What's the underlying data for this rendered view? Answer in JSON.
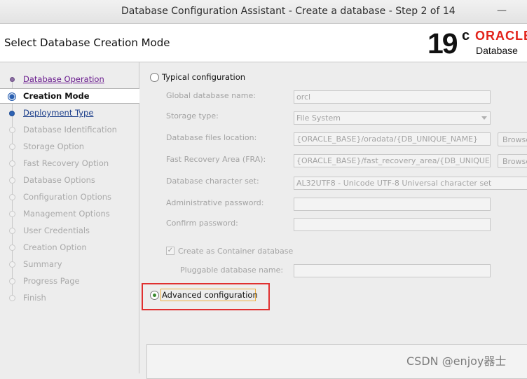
{
  "window": {
    "title": "Database Configuration Assistant - Create a database - Step 2 of 14",
    "minimize_glyph": "—"
  },
  "header": {
    "page_title": "Select Database Creation Mode",
    "logo": {
      "version": "19",
      "superscript": "c",
      "brand": "ORACLE",
      "product": "Database"
    }
  },
  "nav": {
    "items": [
      {
        "label": "Database Operation",
        "state": "done"
      },
      {
        "label": "Creation Mode",
        "state": "current"
      },
      {
        "label": "Deployment Type",
        "state": "next"
      },
      {
        "label": "Database Identification",
        "state": "disabled"
      },
      {
        "label": "Storage Option",
        "state": "disabled"
      },
      {
        "label": "Fast Recovery Option",
        "state": "disabled"
      },
      {
        "label": "Database Options",
        "state": "disabled"
      },
      {
        "label": "Configuration Options",
        "state": "disabled"
      },
      {
        "label": "Management Options",
        "state": "disabled"
      },
      {
        "label": "User Credentials",
        "state": "disabled"
      },
      {
        "label": "Creation Option",
        "state": "disabled"
      },
      {
        "label": "Summary",
        "state": "disabled"
      },
      {
        "label": "Progress Page",
        "state": "disabled"
      },
      {
        "label": "Finish",
        "state": "disabled"
      }
    ]
  },
  "form": {
    "typical_label": "Typical configuration",
    "advanced_label": "Advanced configuration",
    "selected_mode": "advanced",
    "fields": {
      "global_db_name": {
        "label": "Global database name:",
        "value": "orcl"
      },
      "storage_type": {
        "label": "Storage type:",
        "value": "File System"
      },
      "db_files_location": {
        "label": "Database files location:",
        "value": "{ORACLE_BASE}/oradata/{DB_UNIQUE_NAME}",
        "button": "Browse..."
      },
      "fra": {
        "label": "Fast Recovery Area (FRA):",
        "value": "{ORACLE_BASE}/fast_recovery_area/{DB_UNIQUE_NAME}",
        "button": "Browse..."
      },
      "charset": {
        "label": "Database character set:",
        "value": "AL32UTF8 - Unicode UTF-8 Universal character set"
      },
      "admin_password": {
        "label": "Administrative password:",
        "value": ""
      },
      "confirm_password": {
        "label": "Confirm password:",
        "value": ""
      },
      "container_db": {
        "label": "Create as Container database",
        "checked": true
      },
      "pdb_name": {
        "label": "Pluggable database name:",
        "value": ""
      }
    }
  },
  "watermark": "CSDN @enjoy器士",
  "colors": {
    "highlight": "#e03030",
    "oracle_red": "#e2231a",
    "radio_selected": "#3b8a2f"
  }
}
